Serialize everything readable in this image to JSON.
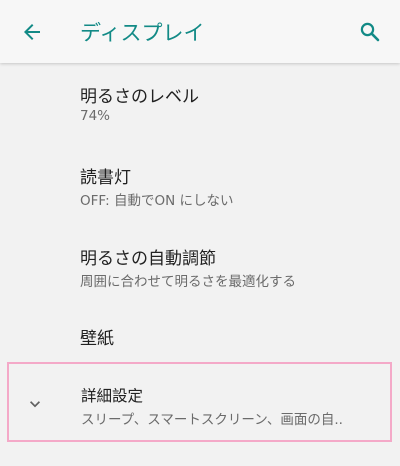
{
  "app_bar": {
    "title": "ディスプレイ",
    "back_icon": "arrow-back-icon",
    "search_icon": "search-icon",
    "accent_color": "#128a86"
  },
  "settings": [
    {
      "title": "明るさのレベル",
      "summary": "74%"
    },
    {
      "title": "読書灯",
      "summary": "OFF: 自動でON にしない"
    },
    {
      "title": "明るさの自動調節",
      "summary": "周囲に合わせて明るさを最適化する"
    },
    {
      "title": "壁紙",
      "summary": ""
    }
  ],
  "advanced": {
    "title": "詳細設定",
    "summary": "スリープ、スマートスクリーン、画面の自..",
    "icon": "chevron-down-icon"
  }
}
